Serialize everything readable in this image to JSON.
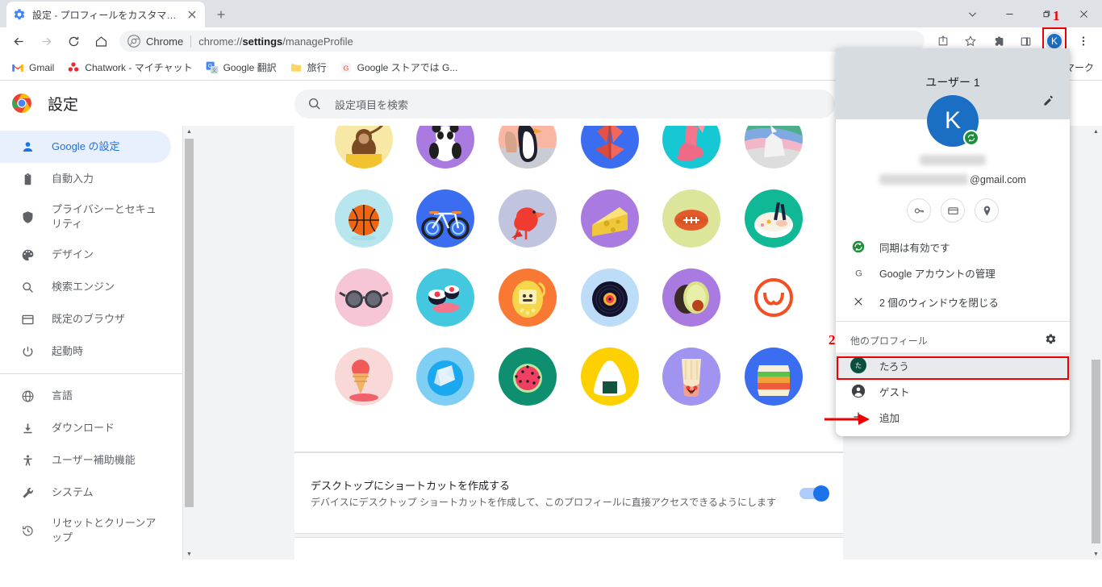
{
  "window": {
    "controls": [
      "chevron-down",
      "minimize",
      "restore",
      "close"
    ]
  },
  "tab": {
    "title": "設定 - プロフィールをカスタマイズ",
    "favicon": "settings-gear-icon",
    "close_label": "×",
    "newtab_label": "+"
  },
  "toolbar": {
    "back": "←",
    "forward": "→",
    "reload": "⟳",
    "home": "⌂",
    "omnibox": {
      "chip": "Chrome",
      "url_prefix": "chrome://",
      "url_bold": "settings",
      "url_suffix": "/manageProfile"
    },
    "right_icons": [
      "share-icon",
      "bookmark-star-icon",
      "extensions-puzzle-icon",
      "side-panel-icon"
    ],
    "avatar_letter": "K",
    "menu": "⋮"
  },
  "bookmarks": {
    "items": [
      {
        "label": "Gmail",
        "icon": "gmail-icon"
      },
      {
        "label": "Chatwork - マイチャット",
        "icon": "chatwork-icon"
      },
      {
        "label": "Google 翻訳",
        "icon": "google-translate-icon"
      },
      {
        "label": "旅行",
        "icon": "folder-icon"
      },
      {
        "label": "Google ストアでは G...",
        "icon": "google-store-icon"
      }
    ],
    "overflow_text": "ブックマーク"
  },
  "settings": {
    "title": "設定",
    "logo": "chrome-logo",
    "search_placeholder": "設定項目を検索",
    "sidebar": [
      {
        "label": "Google の設定",
        "icon": "person-icon",
        "active": true
      },
      {
        "label": "自動入力",
        "icon": "clipboard-icon",
        "active": false
      },
      {
        "label": "プライバシーとセキュリティ",
        "icon": "shield-icon",
        "active": false
      },
      {
        "label": "デザイン",
        "icon": "palette-icon",
        "active": false
      },
      {
        "label": "検索エンジン",
        "icon": "search-icon",
        "active": false
      },
      {
        "label": "既定のブラウザ",
        "icon": "browser-window-icon",
        "active": false
      },
      {
        "label": "起動時",
        "icon": "power-icon",
        "active": false
      }
    ],
    "sidebar_group2": [
      {
        "label": "言語",
        "icon": "globe-icon"
      },
      {
        "label": "ダウンロード",
        "icon": "download-icon"
      },
      {
        "label": "ユーザー補助機能",
        "icon": "accessibility-icon"
      },
      {
        "label": "システム",
        "icon": "wrench-icon"
      },
      {
        "label": "リセットとクリーンアップ",
        "icon": "restore-history-icon"
      }
    ],
    "avatars": [
      {
        "name": "monkey-avatar",
        "bg": "#f7e8a6",
        "fg": "#7a4a22"
      },
      {
        "name": "panda-avatar",
        "bg": "#a97ae0",
        "fg": "#1f1f1f"
      },
      {
        "name": "penguin-avatar",
        "bg": "#f9b6a3",
        "fg": "#1f1f1f"
      },
      {
        "name": "butterfly-avatar",
        "bg": "#3a6df0",
        "fg": "#ef6a5c"
      },
      {
        "name": "rabbit-avatar",
        "bg": "#16c7d4",
        "fg": "#f2778d"
      },
      {
        "name": "unicorn-avatar",
        "bg": "#dddddd",
        "fg": "#4fae8a"
      },
      {
        "name": "basketball-avatar",
        "bg": "#b7e6ee",
        "fg": "#ef6512"
      },
      {
        "name": "bicycle-avatar",
        "bg": "#3a6df0",
        "fg": "#8ed6f5"
      },
      {
        "name": "bird-avatar",
        "bg": "#c1c4de",
        "fg": "#ef3b30"
      },
      {
        "name": "cheese-avatar",
        "bg": "#a97ae0",
        "fg": "#f6d64a"
      },
      {
        "name": "football-avatar",
        "bg": "#dde59a",
        "fg": "#e35b2a"
      },
      {
        "name": "ramen-avatar",
        "bg": "#11b896",
        "fg": "#ffffff"
      },
      {
        "name": "sunglasses-avatar",
        "bg": "#f7c6d6",
        "fg": "#3c3c44"
      },
      {
        "name": "sushi-avatar",
        "bg": "#44c8e0",
        "fg": "#1a1a2e"
      },
      {
        "name": "tamagotchi-avatar",
        "bg": "#f97934",
        "fg": "#f6d64a"
      },
      {
        "name": "vinyl-record-avatar",
        "bg": "#bcdcf7",
        "fg": "#12122b"
      },
      {
        "name": "avocado-avatar",
        "bg": "#a97ae0",
        "fg": "#d9e08a"
      },
      {
        "name": "smile-avatar",
        "bg": "#ffffff",
        "fg": "#f25022"
      },
      {
        "name": "icecream-avatar",
        "bg": "#f9d8d8",
        "fg": "#f25a5a"
      },
      {
        "name": "origami-avatar",
        "bg": "#7fcff5",
        "fg": "#1aa8ef"
      },
      {
        "name": "watermelon-avatar",
        "bg": "#0e8f6f",
        "fg": "#ef3f63"
      },
      {
        "name": "onigiri-avatar",
        "bg": "#fdd000",
        "fg": "#ffffff"
      },
      {
        "name": "bubbletea-avatar",
        "bg": "#a193f0",
        "fg": "#f6e7c6"
      },
      {
        "name": "sandwich-avatar",
        "bg": "#3a6df0",
        "fg": "#f4efd6"
      }
    ],
    "shortcut": {
      "title": "デスクトップにショートカットを作成する",
      "subtitle": "デバイスにデスクトップ ショートカットを作成して、このプロフィールに直接アクセスできるようにします",
      "toggle_state": "on"
    }
  },
  "profile_menu": {
    "name": "ユーザー 1",
    "avatar_letter": "K",
    "edit_icon": "pencil-icon",
    "sync_badge_icon": "sync-icon",
    "email_suffix": "@gmail.com",
    "chips": [
      {
        "name": "password-key-icon"
      },
      {
        "name": "payment-card-icon"
      },
      {
        "name": "address-pin-icon"
      }
    ],
    "rows": [
      {
        "label": "同期は有効です",
        "icon": "sync-on-icon"
      },
      {
        "label": "Google アカウントの管理",
        "icon": "google-g-icon"
      },
      {
        "label": "2 個のウィンドウを閉じる",
        "icon": "close-x-icon"
      }
    ],
    "other_profiles_label": "他のプロフィール",
    "other_profiles_gear": "gear-icon",
    "profiles": [
      {
        "label": "たろう",
        "icon": "profile-avatar-taro",
        "initial": "た",
        "selected": true
      },
      {
        "label": "ゲスト",
        "icon": "guest-person-icon",
        "selected": false
      },
      {
        "label": "追加",
        "icon": "plus-icon",
        "selected": false
      }
    ]
  },
  "annotations": {
    "marker1": "1",
    "marker2": "2",
    "accent_color": "#ee0000"
  }
}
